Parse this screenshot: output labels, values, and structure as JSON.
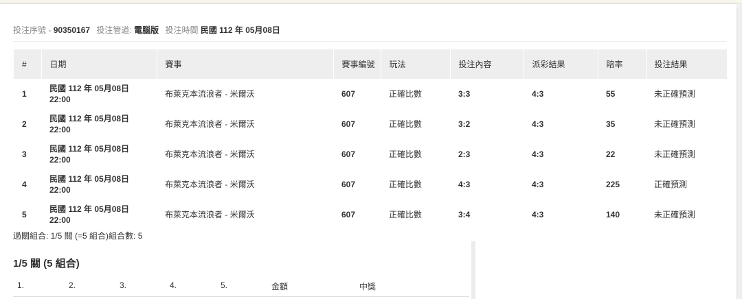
{
  "meta": {
    "serial_label": "投注序號 -",
    "serial_value": "90350167",
    "channel_label": "投注管道:",
    "channel_value": "電腦版",
    "time_label": "投注時間",
    "time_value": "民國 112 年 05月08日"
  },
  "table": {
    "headers": [
      "#",
      "日期",
      "賽事",
      "賽事編號",
      "玩法",
      "投注內容",
      "派彩結果",
      "賠率",
      "投注結果"
    ],
    "rows": [
      {
        "no": "1",
        "date": "民國 112 年 05月08日",
        "time": "22:00",
        "match": "布萊克本流浪者 - 米爾沃",
        "match_id": "607",
        "play": "正確比數",
        "bet": "3:3",
        "result": "4:3",
        "odds": "55",
        "outcome": "未正確預測"
      },
      {
        "no": "2",
        "date": "民國 112 年 05月08日",
        "time": "22:00",
        "match": "布萊克本流浪者 - 米爾沃",
        "match_id": "607",
        "play": "正確比數",
        "bet": "3:2",
        "result": "4:3",
        "odds": "35",
        "outcome": "未正確預測"
      },
      {
        "no": "3",
        "date": "民國 112 年 05月08日",
        "time": "22:00",
        "match": "布萊克本流浪者 - 米爾沃",
        "match_id": "607",
        "play": "正確比數",
        "bet": "2:3",
        "result": "4:3",
        "odds": "22",
        "outcome": "未正確預測"
      },
      {
        "no": "4",
        "date": "民國 112 年 05月08日",
        "time": "22:00",
        "match": "布萊克本流浪者 - 米爾沃",
        "match_id": "607",
        "play": "正確比數",
        "bet": "4:3",
        "result": "4:3",
        "odds": "225",
        "outcome": "正確預測"
      },
      {
        "no": "5",
        "date": "民國 112 年 05月08日",
        "time": "22:00",
        "match": "布萊克本流浪者 - 米爾沃",
        "match_id": "607",
        "play": "正確比數",
        "bet": "3:4",
        "result": "4:3",
        "odds": "140",
        "outcome": "未正確預測"
      }
    ]
  },
  "summary": "過關組合: 1/5 關 (=5 組合)組合數: 5",
  "combo": {
    "title": "1/5 關 (5 組合)",
    "headers": [
      "1.",
      "2.",
      "3.",
      "4.",
      "5.",
      "金額",
      "中獎"
    ]
  }
}
